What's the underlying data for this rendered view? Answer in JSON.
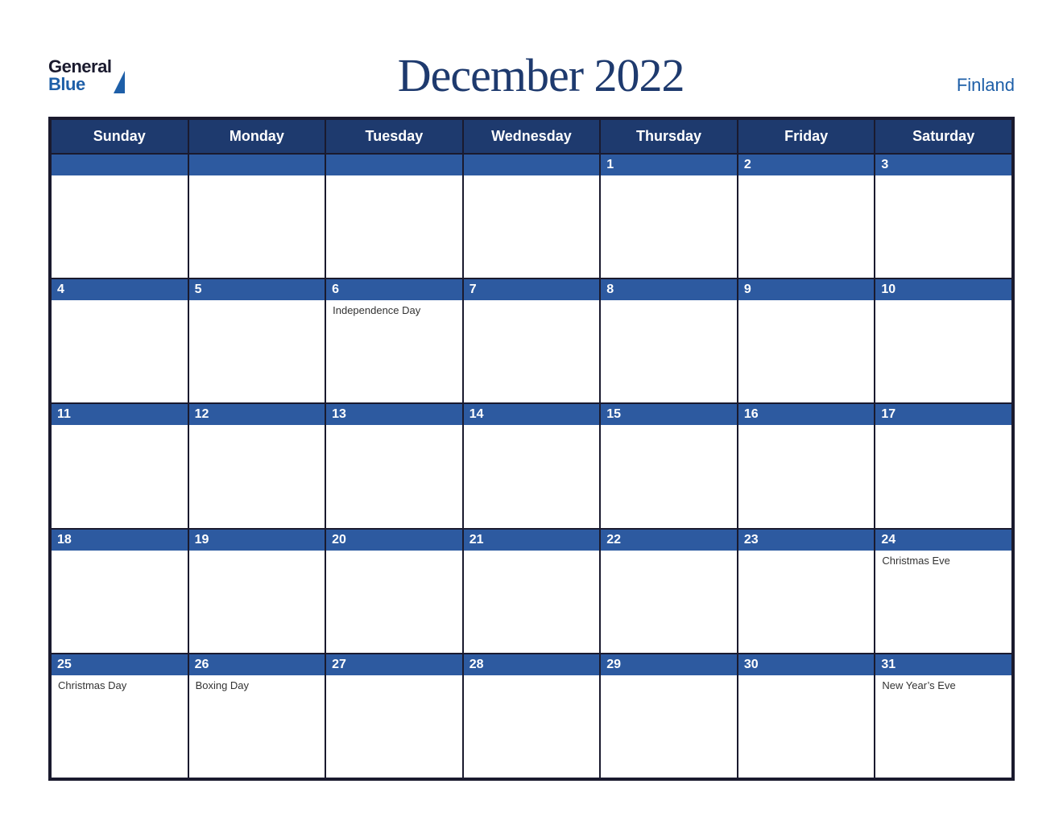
{
  "header": {
    "logo_general": "General",
    "logo_blue": "Blue",
    "title": "December 2022",
    "country": "Finland"
  },
  "days_of_week": [
    "Sunday",
    "Monday",
    "Tuesday",
    "Wednesday",
    "Thursday",
    "Friday",
    "Saturday"
  ],
  "weeks": [
    [
      {
        "num": "",
        "events": []
      },
      {
        "num": "",
        "events": []
      },
      {
        "num": "",
        "events": []
      },
      {
        "num": "",
        "events": []
      },
      {
        "num": "1",
        "events": []
      },
      {
        "num": "2",
        "events": []
      },
      {
        "num": "3",
        "events": []
      }
    ],
    [
      {
        "num": "4",
        "events": []
      },
      {
        "num": "5",
        "events": []
      },
      {
        "num": "6",
        "events": [
          "Independence Day"
        ]
      },
      {
        "num": "7",
        "events": []
      },
      {
        "num": "8",
        "events": []
      },
      {
        "num": "9",
        "events": []
      },
      {
        "num": "10",
        "events": []
      }
    ],
    [
      {
        "num": "11",
        "events": []
      },
      {
        "num": "12",
        "events": []
      },
      {
        "num": "13",
        "events": []
      },
      {
        "num": "14",
        "events": []
      },
      {
        "num": "15",
        "events": []
      },
      {
        "num": "16",
        "events": []
      },
      {
        "num": "17",
        "events": []
      }
    ],
    [
      {
        "num": "18",
        "events": []
      },
      {
        "num": "19",
        "events": []
      },
      {
        "num": "20",
        "events": []
      },
      {
        "num": "21",
        "events": []
      },
      {
        "num": "22",
        "events": []
      },
      {
        "num": "23",
        "events": []
      },
      {
        "num": "24",
        "events": [
          "Christmas Eve"
        ]
      }
    ],
    [
      {
        "num": "25",
        "events": [
          "Christmas Day"
        ]
      },
      {
        "num": "26",
        "events": [
          "Boxing Day"
        ]
      },
      {
        "num": "27",
        "events": []
      },
      {
        "num": "28",
        "events": []
      },
      {
        "num": "29",
        "events": []
      },
      {
        "num": "30",
        "events": []
      },
      {
        "num": "31",
        "events": [
          "New Year’s Eve"
        ]
      }
    ]
  ],
  "colors": {
    "header_bg": "#1e3a6e",
    "cell_number_bg": "#2d5aa0",
    "border": "#1a1a2e",
    "title": "#1e3a6e",
    "country": "#1e5fa8",
    "logo_blue": "#1e5fa8",
    "text_white": "#ffffff"
  }
}
